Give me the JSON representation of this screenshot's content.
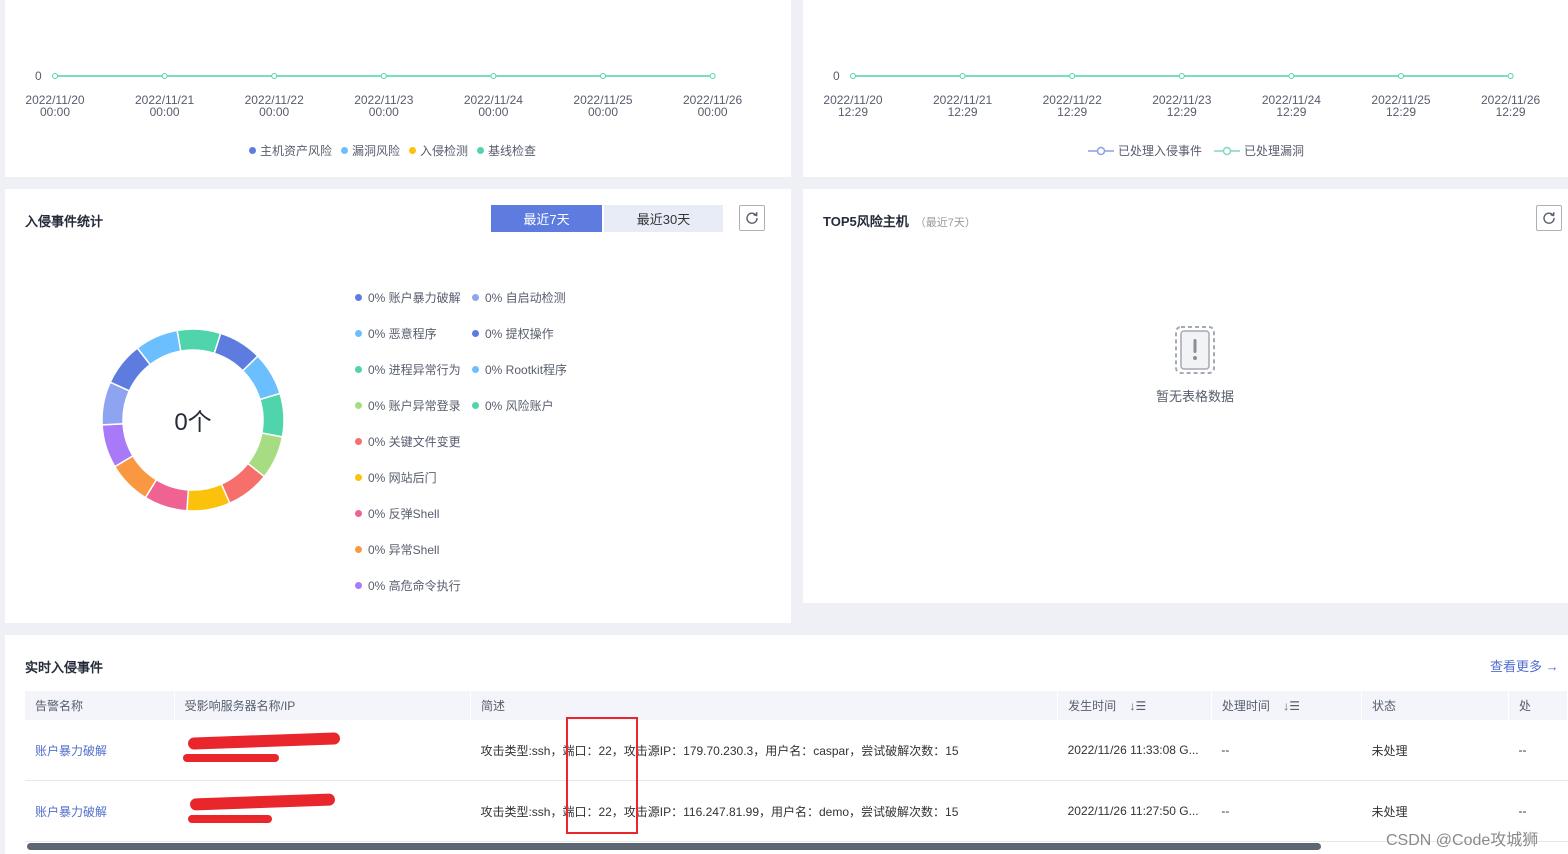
{
  "top_left_chart": {
    "y_zero": "0",
    "x_labels": [
      {
        "date": "2022/11/20",
        "time": "00:00"
      },
      {
        "date": "2022/11/21",
        "time": "00:00"
      },
      {
        "date": "2022/11/22",
        "time": "00:00"
      },
      {
        "date": "2022/11/23",
        "time": "00:00"
      },
      {
        "date": "2022/11/24",
        "time": "00:00"
      },
      {
        "date": "2022/11/25",
        "time": "00:00"
      },
      {
        "date": "2022/11/26",
        "time": "00:00"
      }
    ],
    "legend": [
      {
        "label": "主机资产风险",
        "color": "#5e7ce0"
      },
      {
        "label": "漏洞风险",
        "color": "#6cbfff"
      },
      {
        "label": "入侵检测",
        "color": "#fac20a"
      },
      {
        "label": "基线检查",
        "color": "#50d4ab"
      }
    ],
    "line_color": "#50d4ab"
  },
  "top_right_chart": {
    "y_zero": "0",
    "x_labels": [
      {
        "date": "2022/11/20",
        "time": "12:29"
      },
      {
        "date": "2022/11/21",
        "time": "12:29"
      },
      {
        "date": "2022/11/22",
        "time": "12:29"
      },
      {
        "date": "2022/11/23",
        "time": "12:29"
      },
      {
        "date": "2022/11/24",
        "time": "12:29"
      },
      {
        "date": "2022/11/25",
        "time": "12:29"
      },
      {
        "date": "2022/11/26",
        "time": "12:29"
      }
    ],
    "legend": [
      {
        "label": "已处理入侵事件",
        "color": "#8a9fe6"
      },
      {
        "label": "已处理漏洞",
        "color": "#7fd8c2"
      }
    ],
    "line_color": "#50d4ab"
  },
  "intrusion_stats": {
    "title": "入侵事件统计",
    "btn_7d": "最近7天",
    "btn_30d": "最近30天",
    "center_value": "0个",
    "categories": [
      {
        "label": "0% 账户暴力破解",
        "color": "#5e7ce0"
      },
      {
        "label": "0% 自启动检测",
        "color": "#8fa4f0"
      },
      {
        "label": "0% 恶意程序",
        "color": "#6cbfff"
      },
      {
        "label": "0% 提权操作",
        "color": "#5e7ce0"
      },
      {
        "label": "0% 进程异常行为",
        "color": "#50d4ab"
      },
      {
        "label": "0% Rootkit程序",
        "color": "#6cbfff"
      },
      {
        "label": "0% 账户异常登录",
        "color": "#a6dd82"
      },
      {
        "label": "0% 风险账户",
        "color": "#50d4ab"
      },
      {
        "label": "0% 关键文件变更",
        "color": "#f66f6a"
      },
      {
        "label": "0% 网站后门",
        "color": "#fac20a"
      },
      {
        "label": "0% 反弹Shell",
        "color": "#f06292"
      },
      {
        "label": "0% 异常Shell",
        "color": "#fa9841"
      },
      {
        "label": "0% 高危命令执行",
        "color": "#a97af8"
      }
    ],
    "ring_colors": [
      "#5e7ce0",
      "#6cbfff",
      "#50d4ab",
      "#a6dd82",
      "#f66f6a",
      "#fac20a",
      "#f06292",
      "#fa9841",
      "#a97af8",
      "#8fa4f0",
      "#5e7ce0",
      "#6cbfff",
      "#50d4ab"
    ]
  },
  "top5": {
    "title": "TOP5风险主机",
    "subtitle": "（最近7天）",
    "empty_text": "暂无表格数据"
  },
  "realtime": {
    "title": "实时入侵事件",
    "more": "查看更多 →",
    "columns": [
      "告警名称",
      "受影响服务器名称/IP",
      "简述",
      "发生时间",
      "处理时间",
      "状态",
      "处"
    ],
    "rows": [
      {
        "name": "账户暴力破解",
        "desc": "攻击类型:ssh，端口：22，攻击源IP：179.70.230.3，用户名：caspar，尝试破解次数：15",
        "time": "2022/11/26 11:33:08 G...",
        "handled": "--",
        "status": "未处理",
        "op": "--"
      },
      {
        "name": "账户暴力破解",
        "desc": "攻击类型:ssh，端口：22，攻击源IP：116.247.81.99，用户名：demo，尝试破解次数：15",
        "time": "2022/11/26 11:27:50 G...",
        "handled": "--",
        "status": "未处理",
        "op": "--"
      }
    ]
  },
  "watermark": "CSDN @Code攻城狮"
}
